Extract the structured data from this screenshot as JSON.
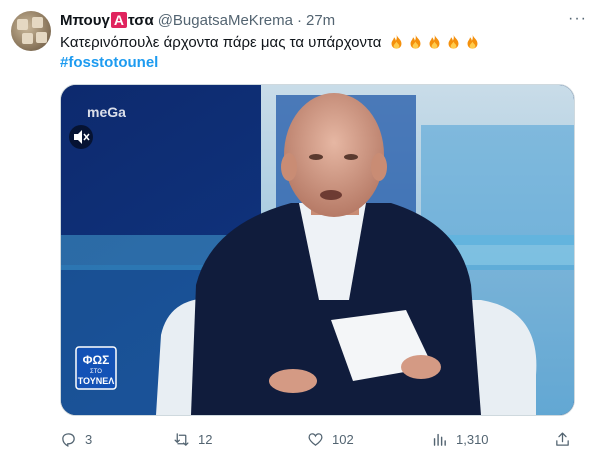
{
  "tweet": {
    "display_name_prefix": "Μπουγ",
    "display_name_badge": "Α",
    "display_name_suffix": "τσα",
    "handle": "@BugatsaMeKrema",
    "separator": "·",
    "time": "27m",
    "more_label": "···",
    "text": "Κατερινόπουλε άρχοντα πάρε μας τα υπάρχοντα",
    "emoji": [
      "fire",
      "fire",
      "fire",
      "fire",
      "fire"
    ],
    "hashtag": "#fosstotounel"
  },
  "media": {
    "channel_logo": "meGa",
    "show_logo_line1": "ΦΩΣ",
    "show_logo_line2": "ΣΤΟ",
    "show_logo_line3": "ΤΟΥΝΕΛ",
    "mute_icon": "speaker-mute-icon"
  },
  "actions": {
    "replies": "3",
    "retweets": "12",
    "likes": "102",
    "views": "1,310"
  },
  "colors": {
    "accent": "#1d9bf0",
    "text_secondary": "#536471",
    "badge": "#e0245e"
  }
}
